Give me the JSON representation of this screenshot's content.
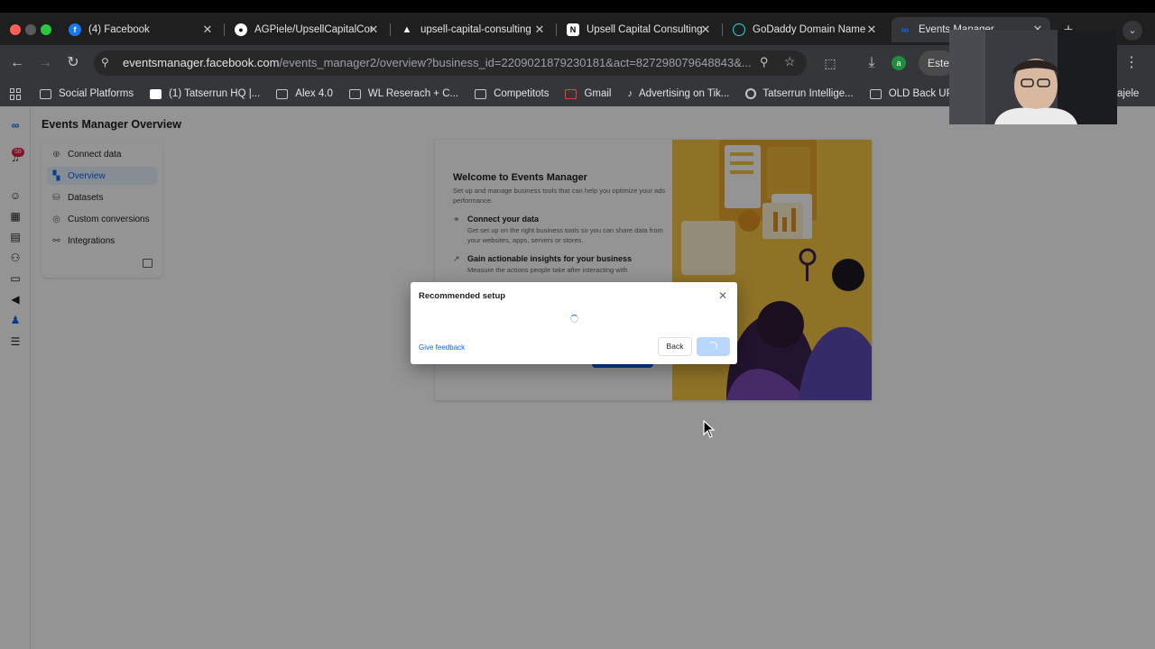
{
  "browser": {
    "tabs": [
      {
        "title": "(4) Facebook",
        "icon": "facebook-icon",
        "icon_color": "#1877f2"
      },
      {
        "title": "AGPiele/UpsellCapitalCon",
        "icon": "github-icon",
        "icon_color": "#ffffff"
      },
      {
        "title": "upsell-capital-consulting",
        "icon": "vercel-icon",
        "icon_color": "#ffffff"
      },
      {
        "title": "Upsell Capital Consulting",
        "icon": "notion-icon",
        "icon_color": "#ffffff"
      },
      {
        "title": "GoDaddy Domain Name",
        "icon": "godaddy-icon",
        "icon_color": "#1bdbdb"
      },
      {
        "title": "Events Manager",
        "icon": "meta-icon",
        "icon_color": "#0866ff"
      }
    ],
    "address": {
      "host": "eventsmanager.facebook.com",
      "path": "/events_manager2/overview?business_id=2209021879230181&act=827298079648843&..."
    },
    "profile_label": "Este",
    "profile_initial": "a",
    "bookmarks": [
      {
        "label": "Social Platforms",
        "icon": "folder-icon"
      },
      {
        "label": "(1) Tatserrun HQ |...",
        "icon": "notion-icon"
      },
      {
        "label": "Alex 4.0",
        "icon": "folder-icon"
      },
      {
        "label": "WL Reserach + C...",
        "icon": "folder-icon"
      },
      {
        "label": "Competitots",
        "icon": "folder-icon"
      },
      {
        "label": "Gmail",
        "icon": "gmail-icon"
      },
      {
        "label": "Advertising on Tik...",
        "icon": "tiktok-icon"
      },
      {
        "label": "Tatserrun Intellige...",
        "icon": "chrome-icon"
      },
      {
        "label": "OLD Back UPs",
        "icon": "folder-icon"
      }
    ],
    "bookmarks_more": "ajele"
  },
  "page": {
    "title": "Events Manager Overview",
    "notification_count": "58",
    "sidebar": [
      {
        "label": "Connect data",
        "icon": "plus-circle-icon"
      },
      {
        "label": "Overview",
        "icon": "overview-icon",
        "active": true
      },
      {
        "label": "Datasets",
        "icon": "datasets-icon"
      },
      {
        "label": "Custom conversions",
        "icon": "custom-conversions-icon"
      },
      {
        "label": "Integrations",
        "icon": "integrations-icon"
      }
    ],
    "welcome": {
      "title": "Welcome to Events Manager",
      "subtitle": "Set up and manage business tools that can help you optimize your ads performance.",
      "steps": [
        {
          "title": "Connect your data",
          "desc": "Get set up on the right business tools so you can share data from your websites, apps, servers or stores."
        },
        {
          "title": "Gain actionable insights for your business",
          "desc": "Measure the actions people take after interacting with"
        }
      ]
    }
  },
  "modal": {
    "title": "Recommended setup",
    "feedback_label": "Give feedback",
    "back_label": "Back"
  },
  "colors": {
    "accent": "#0866ff",
    "illustration": "#f4c542"
  }
}
